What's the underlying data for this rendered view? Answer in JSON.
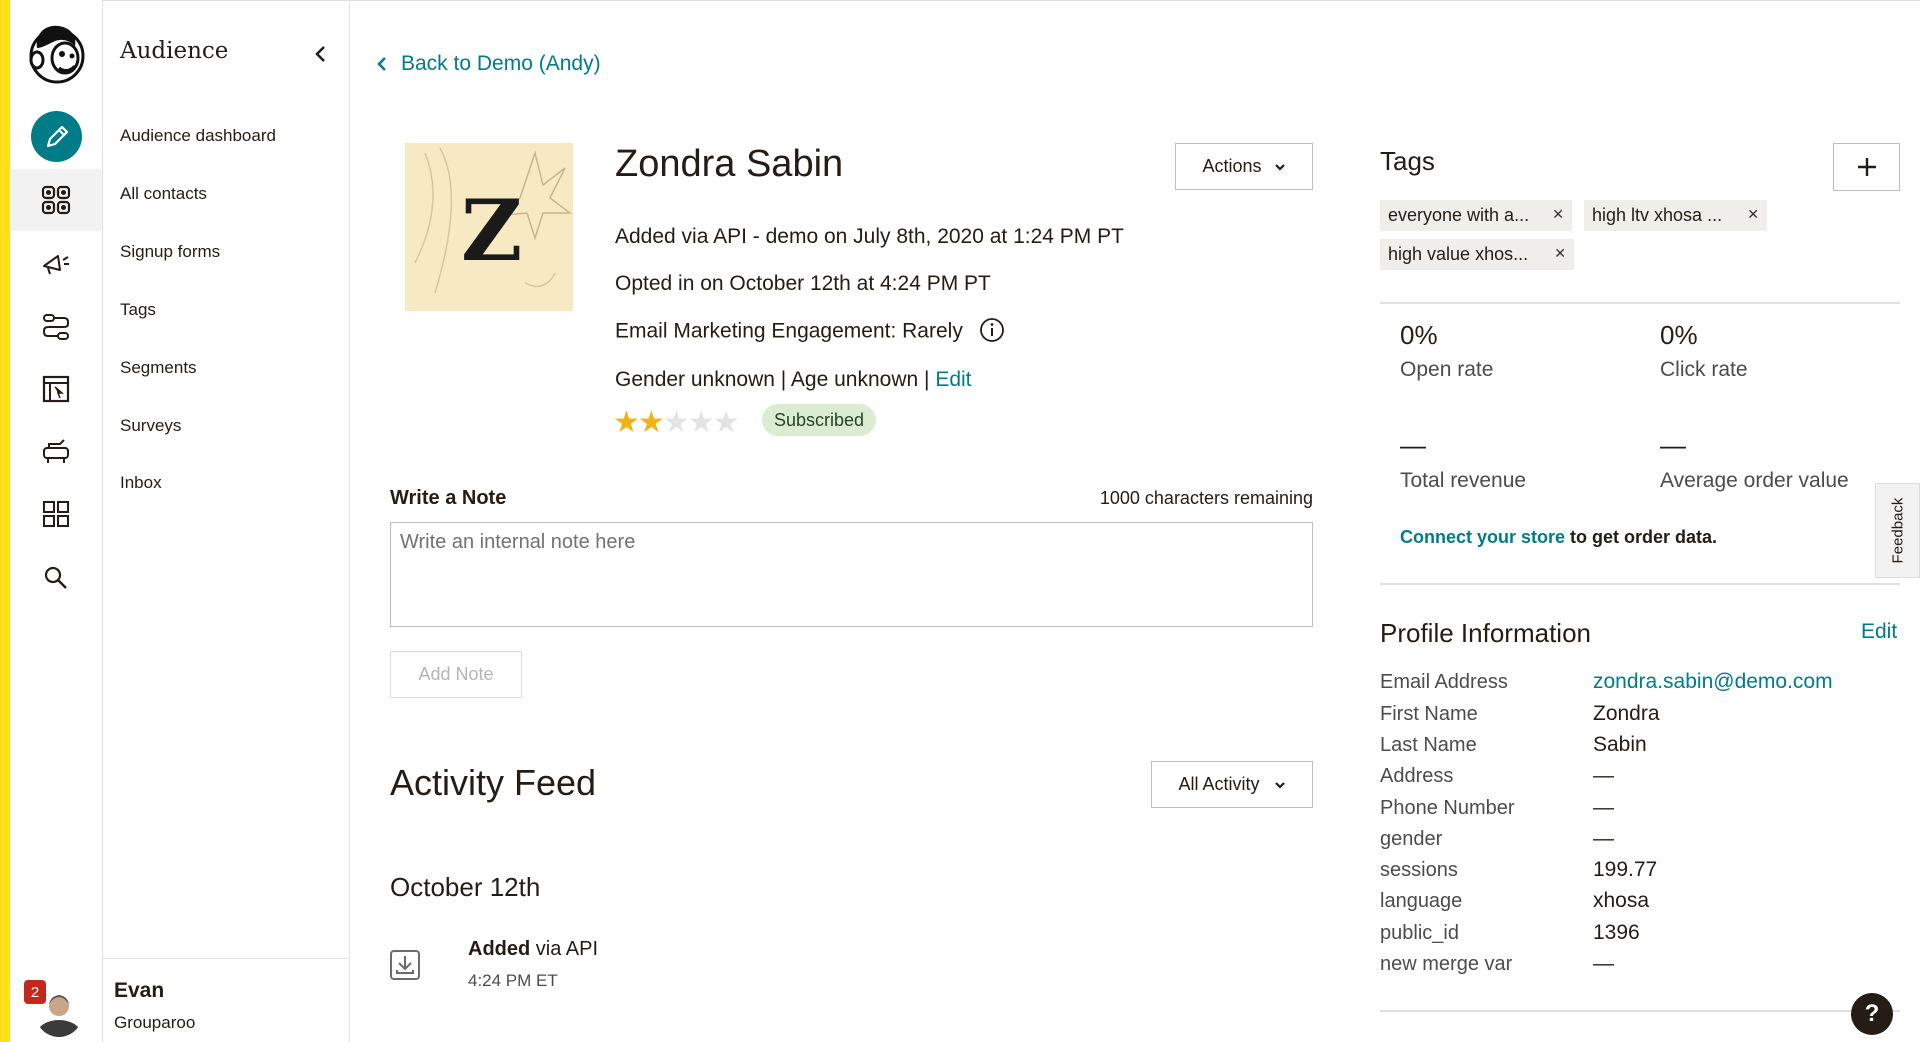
{
  "nav": {
    "title": "Audience",
    "items": [
      {
        "label": "Audience dashboard"
      },
      {
        "label": "All contacts"
      },
      {
        "label": "Signup forms"
      },
      {
        "label": "Tags"
      },
      {
        "label": "Segments"
      },
      {
        "label": "Surveys"
      },
      {
        "label": "Inbox"
      }
    ],
    "user": {
      "name": "Evan",
      "org": "Grouparoo",
      "notifications": "2"
    }
  },
  "back_link": "Back to Demo (Andy)",
  "contact": {
    "initial": "Z",
    "name": "Zondra Sabin",
    "added": "Added via API - demo on July 8th, 2020 at 1:24 PM PT",
    "opted_in": "Opted in on October 12th at 4:24 PM PT",
    "engagement": "Email Marketing Engagement: Rarely",
    "demographics": "Gender unknown | Age unknown |",
    "edit_label": "Edit",
    "rating": 2,
    "rating_max": 5,
    "status": "Subscribed",
    "actions_label": "Actions"
  },
  "note": {
    "label": "Write a Note",
    "remaining": "1000 characters remaining",
    "placeholder": "Write an internal note here",
    "button": "Add Note"
  },
  "feed": {
    "title": "Activity Feed",
    "filter": "All Activity",
    "date": "October 12th",
    "event_bold": "Added",
    "event_rest": " via API",
    "event_time": "4:24 PM ET"
  },
  "tags": {
    "title": "Tags",
    "items": [
      "everyone with a...",
      "high ltv xhosa ...",
      "high value xhos..."
    ]
  },
  "stats": {
    "open_rate_value": "0%",
    "open_rate_label": "Open rate",
    "click_rate_value": "0%",
    "click_rate_label": "Click rate",
    "revenue_value": "—",
    "revenue_label": "Total revenue",
    "aov_value": "—",
    "aov_label": "Average order value",
    "connect_link": "Connect your store",
    "connect_rest": " to get order data."
  },
  "feedback_label": "Feedback",
  "profile": {
    "title": "Profile Information",
    "edit": "Edit",
    "fields": [
      {
        "label": "Email Address",
        "value": "zondra.sabin@demo.com"
      },
      {
        "label": "First Name",
        "value": "Zondra"
      },
      {
        "label": "Last Name",
        "value": "Sabin"
      },
      {
        "label": "Address",
        "value": "—"
      },
      {
        "label": "Phone Number",
        "value": "—"
      },
      {
        "label": "gender",
        "value": "—"
      },
      {
        "label": "sessions",
        "value": "199.77"
      },
      {
        "label": "language",
        "value": "xhosa"
      },
      {
        "label": "public_id",
        "value": "1396"
      },
      {
        "label": "new merge var",
        "value": "—"
      }
    ]
  },
  "help_label": "?",
  "colors": {
    "accent": "#007c89",
    "brand_yellow": "#ffe01b",
    "star": "#f2b31a",
    "subscribed_bg": "#dbecd3"
  }
}
